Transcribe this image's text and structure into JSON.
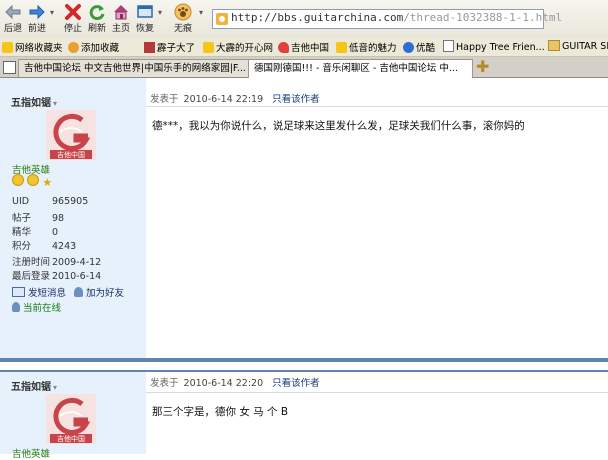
{
  "toolbar": {
    "back_label": "后退",
    "forward_label": "前进",
    "stop_label": "停止",
    "refresh_label": "刷新",
    "home_label": "主页",
    "restore_label": "恢复",
    "noimage_label": "无痕",
    "url_main": "http://bbs.guitarchina.com",
    "url_path": "/thread-1032388-1-1.html"
  },
  "bookmarks": [
    {
      "label": "网络收藏夹",
      "icon": "star-icon"
    },
    {
      "label": "添加收藏",
      "icon": "add-favorite-icon"
    },
    {
      "label": "霹子大了",
      "icon": "site-icon"
    },
    {
      "label": "大霹的开心网",
      "icon": "star-icon"
    },
    {
      "label": "吉他中国",
      "icon": "heart-icon"
    },
    {
      "label": "低音的魅力",
      "icon": "star-icon"
    },
    {
      "label": "优酷",
      "icon": "play-icon"
    },
    {
      "label": "Happy Tree Frien...",
      "icon": "page-icon"
    },
    {
      "label": "GUITAR SH",
      "icon": "folder-icon"
    }
  ],
  "tabs": [
    {
      "label": "吉他中国论坛 中文吉他世界|中国乐手的网络家园|F...",
      "active": false
    },
    {
      "label": "德国刚德国!!! - 音乐闲聊区 - 吉他中国论坛 中...",
      "active": true
    }
  ],
  "posts": [
    {
      "author": "五指如锯",
      "rank": "吉他英雄",
      "avatar_text": "吉他中国",
      "uid_label": "UID",
      "uid": "965905",
      "posts_label": "帖子",
      "posts": "98",
      "digest_label": "精华",
      "digest": "0",
      "credits_label": "积分",
      "credits": "4243",
      "reg_label": "注册时间",
      "reg": "2009-4-12",
      "last_label": "最后登录",
      "last": "2010-6-14",
      "msg_label": "发短消息",
      "friend_label": "加为好友",
      "online_label": "当前在线",
      "posted_label": "发表于",
      "posted_time": "2010-6-14 22:19",
      "only_author": "只看该作者",
      "body": "德***，我以为你说什么，说足球来这里发什么发，足球关我们什么事，滚你妈的"
    },
    {
      "author": "五指如锯",
      "rank": "吉他英雄",
      "avatar_text": "吉他中国",
      "posted_label": "发表于",
      "posted_time": "2010-6-14 22:20",
      "only_author": "只看该作者",
      "body": "那三个字是，德你 女 马 个 B"
    }
  ],
  "colors": {
    "sidebar_bg": "#e6f1fb",
    "post_border": "#5e86b0",
    "rank_green": "#2a7d10",
    "link_blue": "#1a3d7e",
    "avatar_red": "#c8434a"
  }
}
